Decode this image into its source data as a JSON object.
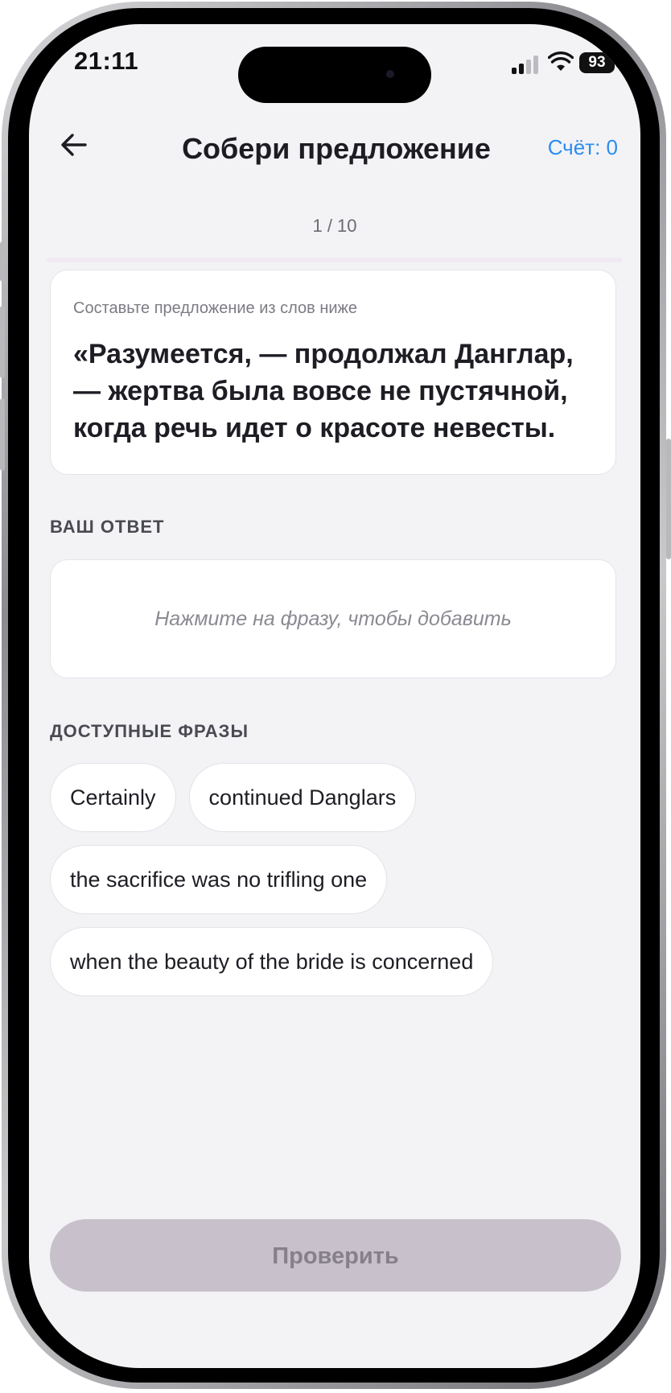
{
  "status_bar": {
    "time": "21:11",
    "battery": "93"
  },
  "header": {
    "title": "Собери предложение",
    "score": "Счёт: 0"
  },
  "progress": "1 / 10",
  "prompt": {
    "hint": "Составьте предложение из слов ниже",
    "sentence": "«Разумеется, — продолжал Данглар, — жертва была вовсе не пустячной, когда речь идет о красоте невесты."
  },
  "answer": {
    "label": "ВАШ ОТВЕТ",
    "placeholder": "Нажмите на фразу, чтобы добавить"
  },
  "phrases": {
    "label": "ДОСТУПНЫЕ ФРАЗЫ",
    "items": [
      "Certainly",
      "continued Danglars",
      "the sacrifice was no trifling one",
      "when the beauty of the bride is concerned"
    ]
  },
  "check_button": "Проверить",
  "colors": {
    "accent": "#2b8cf2",
    "background": "#f3f3f6",
    "button_disabled": "#c8c1cb"
  }
}
